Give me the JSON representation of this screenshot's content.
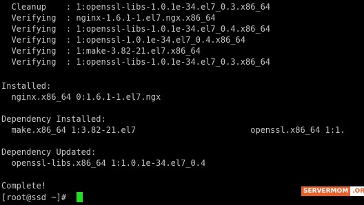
{
  "terminal": {
    "lines": [
      "  Cleanup    : 1:openssl-libs-1.0.1e-34.el7_0.3.x86_64",
      "  Verifying  : nginx-1.6.1-1.el7.ngx.x86_64",
      "  Verifying  : 1:openssl-libs-1.0.1e-34.el7_0.4.x86_64",
      "  Verifying  : 1:openssl-1.0.1e-34.el7_0.4.x86_64",
      "  Verifying  : 1:make-3.82-21.el7.x86_64",
      "  Verifying  : 1:openssl-libs-1.0.1e-34.el7_0.3.x86_64",
      "",
      "Installed:",
      "  nginx.x86_64 0:1.6.1-1.el7.ngx",
      "",
      "Dependency Installed:",
      "  make.x86_64 1:3.82-21.el7                       openssl.x86_64 1:1.",
      "",
      "Dependency Updated:",
      "  openssl-libs.x86_64 1:1.0.1e-34.el7_0.4",
      "",
      "Complete!",
      "[root@ssd ~]# "
    ]
  },
  "watermark": {
    "part1": "SERVERMOM",
    "part2": ".ORG"
  },
  "colors": {
    "background": "#000000",
    "text": "#c8c8c8",
    "cursor": "#22dd22",
    "watermark_accent": "#e8612c"
  }
}
